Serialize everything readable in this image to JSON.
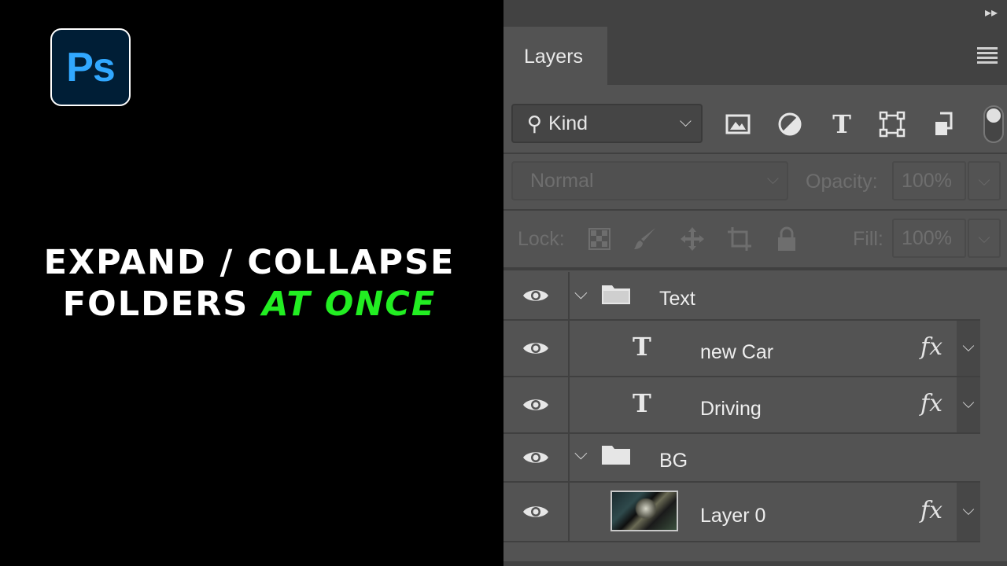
{
  "promo": {
    "logo_text": "Ps",
    "headline_line1": "EXPAND / COLLAPSE",
    "headline_line2_prefix": "FOLDERS ",
    "headline_line2_accent": "AT ONCE",
    "accent_color": "#22ee22",
    "logo_color": "#31a8ff"
  },
  "panel": {
    "collapse_glyph": "▸▸",
    "tab_label": "Layers",
    "filter": {
      "kind_label": "Kind",
      "search_glyph": "⚲",
      "chevron": "⌵",
      "icons": [
        "image-filter-icon",
        "adjustment-filter-icon",
        "type-filter-icon",
        "shape-filter-icon",
        "smart-object-filter-icon"
      ],
      "type_glyph": "T"
    },
    "blend": {
      "mode": "Normal",
      "opacity_label": "Opacity:",
      "opacity_value": "100%",
      "lock_label": "Lock:",
      "fill_label": "Fill:",
      "fill_value": "100%"
    },
    "layers": [
      {
        "name": "Text",
        "kind": "group",
        "expanded": true
      },
      {
        "name": "new Car",
        "kind": "type",
        "fx": "fx"
      },
      {
        "name": "Driving",
        "kind": "type",
        "fx": "fx"
      },
      {
        "name": "BG",
        "kind": "group",
        "expanded": true
      },
      {
        "name": "Layer 0",
        "kind": "pixel",
        "fx": "fx"
      }
    ],
    "type_glyph": "T",
    "twirl_glyph": "⌵",
    "fx_chevron": "⌵"
  }
}
